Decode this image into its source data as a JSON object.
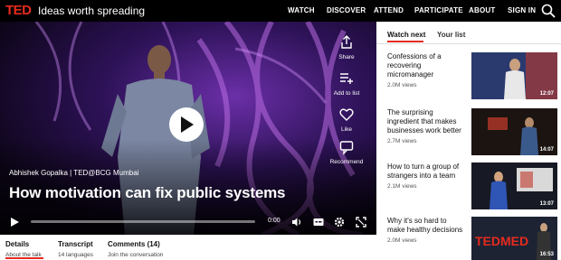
{
  "header": {
    "logo": "TED",
    "tagline": "Ideas worth spreading",
    "nav": [
      "WATCH",
      "DISCOVER",
      "ATTEND",
      "PARTICIPATE",
      "ABOUT",
      "SIGN IN"
    ],
    "search_icon": "search-icon"
  },
  "video": {
    "speaker_line": "Abhishek Gopalka | TED@BCG Mumbai",
    "title": "How motivation can fix public systems",
    "time": "0:00",
    "progress": 0,
    "actions": [
      {
        "label": "Share",
        "icon": "share-icon"
      },
      {
        "label": "Add to list",
        "icon": "add-to-list-icon"
      },
      {
        "label": "Like",
        "icon": "heart-icon"
      },
      {
        "label": "Recommend",
        "icon": "recommend-icon"
      }
    ]
  },
  "tabs": [
    {
      "title": "Details",
      "sub": "About the talk"
    },
    {
      "title": "Transcript",
      "sub": "14 languages"
    },
    {
      "title": "Comments (14)",
      "sub": "Join the conversation"
    }
  ],
  "panel": {
    "tab_active": "Watch next",
    "tab_other": "Your list",
    "items": [
      {
        "title": "Confessions of a recovering micromanager",
        "views": "2.0M views",
        "duration": "12:07"
      },
      {
        "title": "The surprising ingredient that makes businesses work better",
        "views": "2.7M views",
        "duration": "14:07"
      },
      {
        "title": "How to turn a group of strangers into a team",
        "views": "2.1M views",
        "duration": "13:07"
      },
      {
        "title": "Why it's so hard to make healthy decisions",
        "views": "2.0M views",
        "duration": "16:53"
      }
    ]
  },
  "colors": {
    "brand": "#e62b1e",
    "nav_bg": "#000000"
  }
}
